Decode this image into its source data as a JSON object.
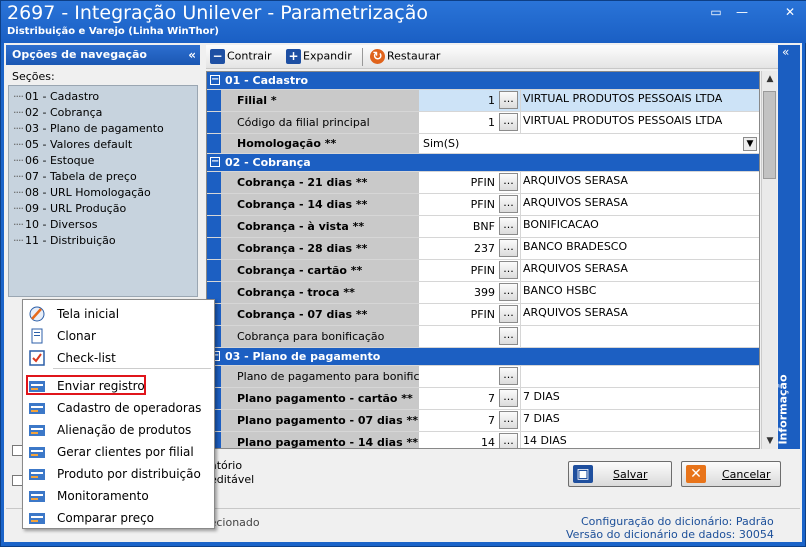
{
  "window": {
    "title": "2697 - Integração Unilever - Parametrização",
    "subtitle": "Distribuição e Varejo (Linha WinThor)"
  },
  "nav": {
    "header": "Opções de navegação",
    "sections_label": "Seções:",
    "sections": [
      "01 - Cadastro",
      "02 - Cobrança",
      "03 - Plano de pagamento",
      "05 - Valores default",
      "06 - Estoque",
      "07 - Tabela de preço",
      "08 - URL Homologação",
      "09 - URL Produção",
      "10 - Diversos",
      "11 - Distribuição"
    ]
  },
  "popup_menu": {
    "items": [
      {
        "label": "Tela inicial",
        "icon": "home-icon"
      },
      {
        "label": "Clonar",
        "icon": "clone-icon"
      },
      {
        "label": "Check-list",
        "icon": "checklist-icon"
      },
      {
        "label": "Enviar registro",
        "icon": "send-record-icon"
      },
      {
        "label": "Cadastro de operadoras",
        "icon": "operators-icon"
      },
      {
        "label": "Alienação de produtos",
        "icon": "products-icon"
      },
      {
        "label": "Gerar clientes por filial",
        "icon": "clients-icon"
      },
      {
        "label": "Produto por distribuição",
        "icon": "distribution-icon"
      },
      {
        "label": "Monitoramento",
        "icon": "monitor-icon"
      },
      {
        "label": "Comparar preço",
        "icon": "compare-icon"
      }
    ],
    "highlighted": "Enviar registro"
  },
  "toolbar": {
    "contrair": "Contrair",
    "expandir": "Expandir",
    "restaurar": "Restaurar"
  },
  "grid": {
    "cadastro": {
      "title": "01 - Cadastro",
      "filial": {
        "name": "Filial *",
        "code": "1",
        "desc": "VIRTUAL PRODUTOS PESSOAIS LTDA"
      },
      "filial_principal": {
        "name": "Código da filial principal",
        "code": "1",
        "desc": "VIRTUAL PRODUTOS PESSOAIS LTDA"
      },
      "homologacao": {
        "name": "Homologação **",
        "value": "Sim(S)"
      }
    },
    "cobranca": {
      "title": "02 - Cobrança",
      "rows": [
        {
          "name": "Cobrança - 21 dias **",
          "code": "PFIN",
          "desc": "ARQUIVOS SERASA"
        },
        {
          "name": "Cobrança - 14 dias **",
          "code": "PFIN",
          "desc": "ARQUIVOS SERASA"
        },
        {
          "name": "Cobrança - à vista **",
          "code": "BNF",
          "desc": "BONIFICACAO"
        },
        {
          "name": "Cobrança - 28 dias **",
          "code": "237",
          "desc": "BANCO BRADESCO"
        },
        {
          "name": "Cobrança - cartão **",
          "code": "PFIN",
          "desc": "ARQUIVOS SERASA"
        },
        {
          "name": "Cobrança - troca **",
          "code": "399",
          "desc": "BANCO HSBC"
        },
        {
          "name": "Cobrança - 07 dias **",
          "code": "PFIN",
          "desc": "ARQUIVOS SERASA"
        },
        {
          "name": "Cobrança para bonificação",
          "code": "",
          "desc": ""
        }
      ]
    },
    "plano": {
      "title": "03 - Plano de pagamento",
      "rows": [
        {
          "name": "Plano de pagamento para bonificação",
          "code": "",
          "desc": ""
        },
        {
          "name": "Plano pagamento - cartão **",
          "code": "7",
          "desc": "7 DIAS"
        },
        {
          "name": "Plano pagamento - 07 dias **",
          "code": "7",
          "desc": "7 DIAS"
        },
        {
          "name": "Plano pagamento - 14 dias **",
          "code": "14",
          "desc": "14 DIAS"
        }
      ]
    },
    "dots": "..."
  },
  "info_panel": {
    "label": "Informação"
  },
  "legend": {
    "required": "atório",
    "editable": "editável"
  },
  "buttons": {
    "save": "Salvar",
    "cancel": "Cancelar"
  },
  "status": {
    "left": "Ações relacionadas ao registro selecionado",
    "dict_config": "Configuração do dicionário: Padrão",
    "dict_version": "Versão do dicionário de dados: 30054"
  }
}
